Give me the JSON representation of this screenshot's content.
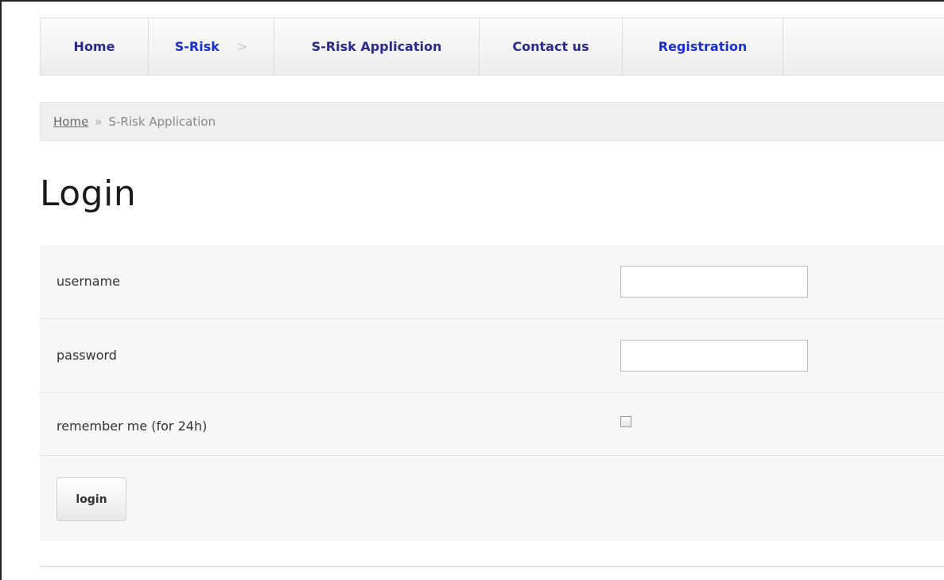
{
  "nav": {
    "items": [
      {
        "label": "Home"
      },
      {
        "label": "S-Risk",
        "has_chevron": true,
        "chevron": ">"
      },
      {
        "label": "S-Risk Application"
      },
      {
        "label": "Contact us"
      },
      {
        "label": "Registration"
      }
    ]
  },
  "breadcrumb": {
    "home": "Home",
    "separator": "»",
    "current": "S-Risk Application"
  },
  "page": {
    "title": "Login"
  },
  "form": {
    "username_label": "username",
    "username_value": "",
    "password_label": "password",
    "password_value": "",
    "remember_label": "remember me (for 24h)",
    "remember_checked": false,
    "submit_label": "login"
  },
  "colors": {
    "nav_text": "#2a2a8a",
    "nav_text_blue": "#1b2fd6",
    "form_background": "#f7f7f7"
  }
}
